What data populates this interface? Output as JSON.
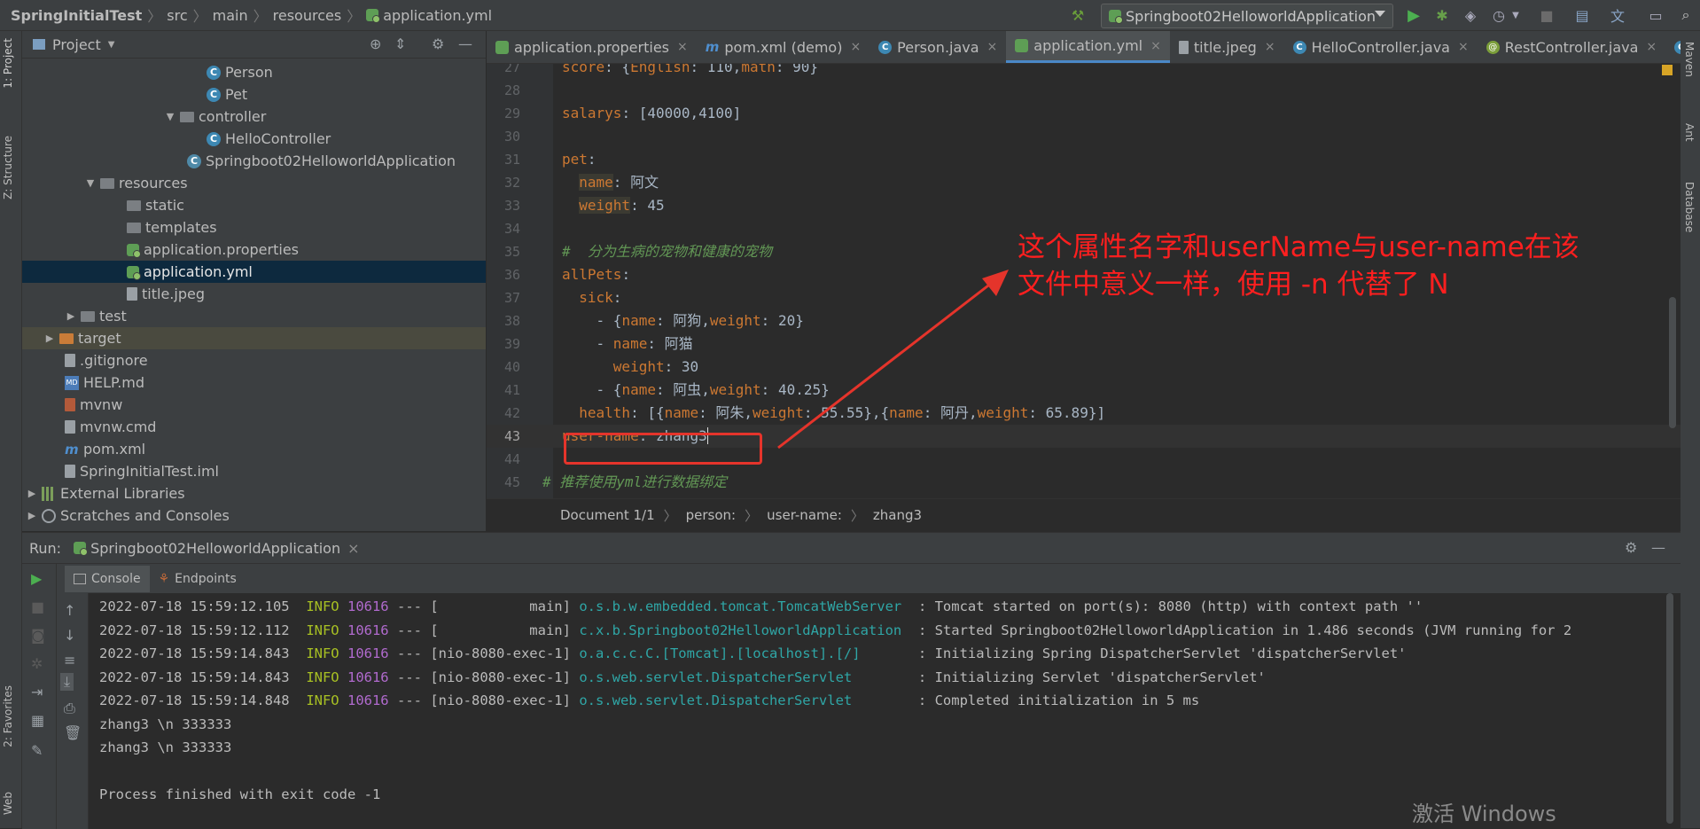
{
  "navbar": {
    "breadcrumb": [
      "SpringInitialTest",
      "src",
      "main",
      "resources",
      "application.yml"
    ],
    "run_config": "Springboot02HelloworldApplication"
  },
  "left_strip": {
    "project": "1: Project",
    "structure": "Z: Structure",
    "favorites": "2: Favorites",
    "web": "Web"
  },
  "right_strip": {
    "maven": "Maven",
    "ant": "Ant",
    "database": "Database"
  },
  "project_panel": {
    "title": "Project",
    "tree": [
      {
        "label": "Person",
        "icon": "class-icon",
        "indent": 0
      },
      {
        "label": "Pet",
        "icon": "class-icon",
        "indent": 0
      },
      {
        "label": "controller",
        "icon": "folder-icon",
        "indent": 0
      },
      {
        "label": "HelloController",
        "icon": "class-icon",
        "indent": 0
      },
      {
        "label": "Springboot02HelloworldApplication",
        "icon": "spring-class-icon",
        "indent": 0
      },
      {
        "label": "resources",
        "icon": "resources-folder-icon",
        "indent": 0
      },
      {
        "label": "static",
        "icon": "folder-icon",
        "indent": 0
      },
      {
        "label": "templates",
        "icon": "folder-icon",
        "indent": 0
      },
      {
        "label": "application.properties",
        "icon": "properties-icon",
        "indent": 0
      },
      {
        "label": "application.yml",
        "icon": "yml-icon",
        "indent": 0
      },
      {
        "label": "title.jpeg",
        "icon": "image-icon",
        "indent": 0
      },
      {
        "label": "test",
        "icon": "folder-icon",
        "indent": 0
      },
      {
        "label": "target",
        "icon": "folder-icon",
        "indent": 0
      },
      {
        "label": ".gitignore",
        "icon": "file-icon",
        "indent": 0
      },
      {
        "label": "HELP.md",
        "icon": "md-icon",
        "indent": 0
      },
      {
        "label": "mvnw",
        "icon": "file-icon",
        "indent": 0
      },
      {
        "label": "mvnw.cmd",
        "icon": "file-icon",
        "indent": 0
      },
      {
        "label": "pom.xml",
        "icon": "maven-icon",
        "indent": 0
      },
      {
        "label": "SpringInitialTest.iml",
        "icon": "file-icon",
        "indent": 0
      },
      {
        "label": "External Libraries",
        "icon": "library-icon",
        "indent": 0
      },
      {
        "label": "Scratches and Consoles",
        "icon": "scratch-icon",
        "indent": 0
      }
    ]
  },
  "editor": {
    "tabs": [
      {
        "label": "application.properties",
        "icon": "properties-icon"
      },
      {
        "label": "pom.xml (demo)",
        "icon": "maven-icon"
      },
      {
        "label": "Person.java",
        "icon": "class-icon"
      },
      {
        "label": "application.yml",
        "icon": "yml-icon"
      },
      {
        "label": "title.jpeg",
        "icon": "image-icon"
      },
      {
        "label": "HelloController.java",
        "icon": "class-icon"
      },
      {
        "label": "RestController.java",
        "icon": "rest-icon"
      },
      {
        "label": "P",
        "icon": "class-icon"
      }
    ],
    "line_numbers": [
      "27",
      "28",
      "29",
      "30",
      "31",
      "32",
      "33",
      "34",
      "35",
      "36",
      "37",
      "38",
      "39",
      "40",
      "41",
      "42",
      "43",
      "44",
      "45"
    ],
    "annotation": "这个属性名字和userName与user-name在该文件中意义一样，使用 -n 代替了 N",
    "doc_breadcrumb": [
      "Document 1/1",
      "person:",
      "user-name:",
      "zhang3"
    ]
  },
  "run_panel": {
    "label": "Run:",
    "config_tab": "Springboot02HelloworldApplication",
    "console_tab": "Console",
    "endpoints_tab": "Endpoints",
    "log_lines": [
      {
        "ts": "2022-07-18 15:59:12.105",
        "level": "INFO",
        "pid": "10616",
        "thread": "--- [           main]",
        "logger": "o.s.b.w.embedded.tomcat.TomcatWebServer",
        "msg": " : Tomcat started on port(s): 8080 (http) with context path ''"
      },
      {
        "ts": "2022-07-18 15:59:12.112",
        "level": "INFO",
        "pid": "10616",
        "thread": "--- [           main]",
        "logger": "c.x.b.Springboot02HelloworldApplication",
        "msg": " : Started Springboot02HelloworldApplication in 1.486 seconds (JVM running for 2"
      },
      {
        "ts": "2022-07-18 15:59:14.843",
        "level": "INFO",
        "pid": "10616",
        "thread": "--- [nio-8080-exec-1]",
        "logger": "o.a.c.c.C.[Tomcat].[localhost].[/]",
        "msg": " : Initializing Spring DispatcherServlet 'dispatcherServlet'"
      },
      {
        "ts": "2022-07-18 15:59:14.843",
        "level": "INFO",
        "pid": "10616",
        "thread": "--- [nio-8080-exec-1]",
        "logger": "o.s.web.servlet.DispatcherServlet",
        "msg": " : Initializing Servlet 'dispatcherServlet'"
      },
      {
        "ts": "2022-07-18 15:59:14.848",
        "level": "INFO",
        "pid": "10616",
        "thread": "--- [nio-8080-exec-1]",
        "logger": "o.s.web.servlet.DispatcherServlet",
        "msg": " : Completed initialization in 5 ms"
      }
    ],
    "output_lines": [
      "zhang3 \\n 333333",
      "zhang3 \\n 333333",
      "",
      "Process finished with exit code -1"
    ]
  },
  "watermark": "激活 Windows"
}
